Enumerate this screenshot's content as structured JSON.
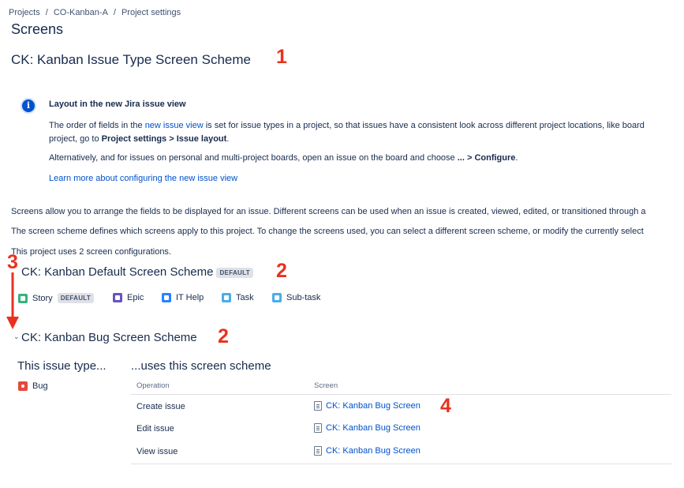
{
  "breadcrumb": [
    "Projects",
    "CO-Kanban-A",
    "Project settings"
  ],
  "page_title": "Screens",
  "scheme_title": "CK: Kanban Issue Type Screen Scheme",
  "annotations": [
    "1",
    "2",
    "2",
    "3",
    "4"
  ],
  "info": {
    "icon": "info-icon",
    "title": "Layout in the new Jira issue view",
    "p1_before": "The order of fields in the ",
    "p1_link": "new issue view",
    "p1_after": " is set for issue types in a project, so that issues have a consistent look across different project locations, like board",
    "p1_line2_before": "project, go to ",
    "p1_line2_bold": "Project settings > Issue layout",
    "p1_line2_after": ".",
    "p2_before": "Alternatively, and for issues on personal and multi-project boards, open an issue on the board and choose ",
    "p2_bold": "... > Configure",
    "p2_after": ".",
    "learn_more": "Learn more about configuring the new issue view"
  },
  "desc1": "Screens allow you to arrange the fields to be displayed for an issue. Different screens can be used when an issue is created, viewed, edited, or transitioned through a",
  "desc2": "The screen scheme defines which screens apply to this project. To change the screens used, you can select a different screen scheme, or modify the currently select",
  "desc3": "This project uses 2 screen configurations.",
  "default_scheme": {
    "title": "CK: Kanban Default Screen Scheme",
    "badge": "DEFAULT",
    "issue_types": [
      {
        "label": "Story",
        "icon": "story-icon",
        "badge": "DEFAULT"
      },
      {
        "label": "Epic",
        "icon": "epic-icon"
      },
      {
        "label": "IT Help",
        "icon": "it-help-icon"
      },
      {
        "label": "Task",
        "icon": "task-icon"
      },
      {
        "label": "Sub-task",
        "icon": "subtask-icon"
      }
    ]
  },
  "bug_scheme": {
    "title": "CK: Kanban Bug Screen Scheme",
    "left_heading": "This issue type...",
    "right_heading": "...uses this screen scheme",
    "issue_type": {
      "label": "Bug",
      "icon": "bug-icon"
    },
    "columns": [
      "Operation",
      "Screen"
    ],
    "rows": [
      {
        "operation": "Create issue",
        "screen": "CK: Kanban Bug Screen"
      },
      {
        "operation": "Edit issue",
        "screen": "CK: Kanban Bug Screen"
      },
      {
        "operation": "View issue",
        "screen": "CK: Kanban Bug Screen"
      }
    ]
  }
}
